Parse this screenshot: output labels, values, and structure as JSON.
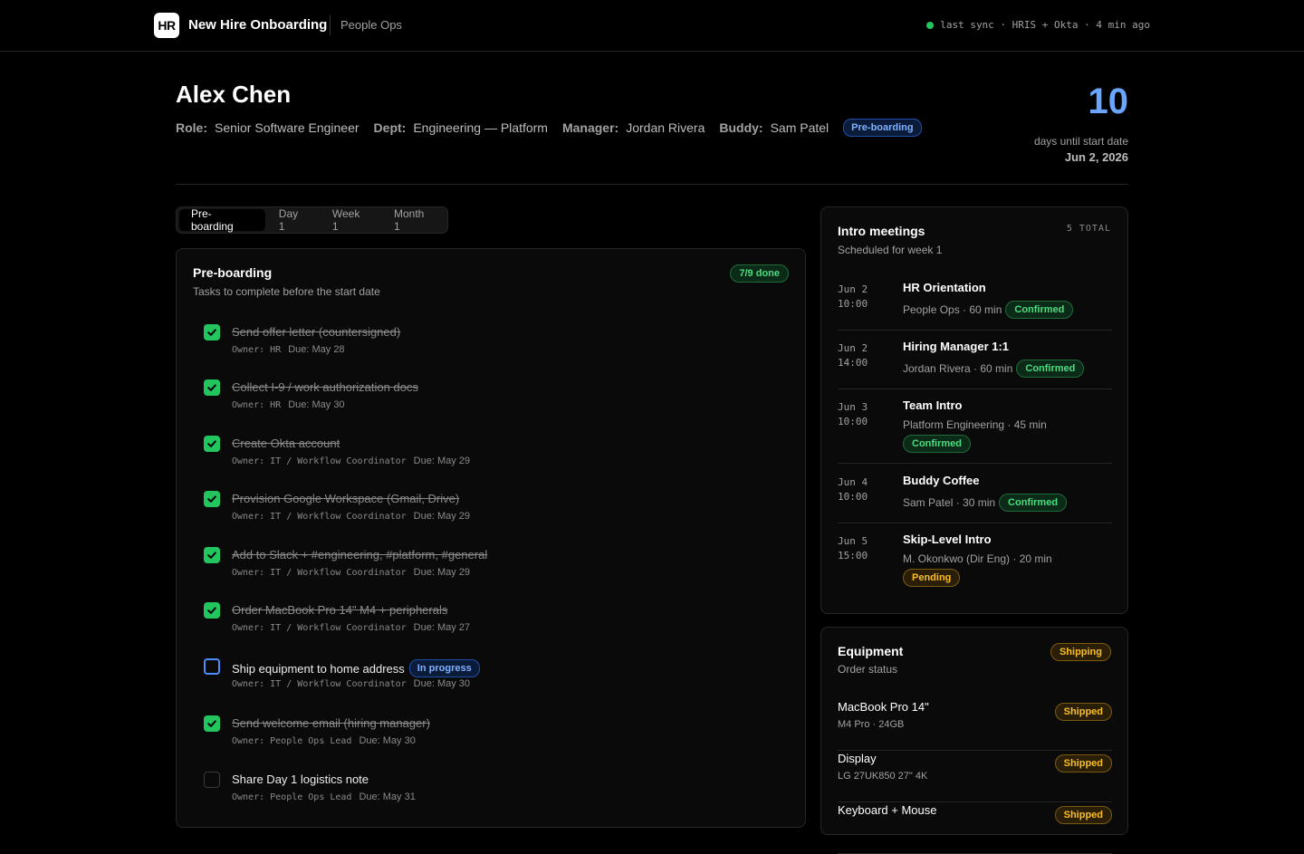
{
  "topbar": {
    "logo": "HR",
    "title": "New Hire Onboarding",
    "section": "People Ops",
    "sync_text": "last sync · HRIS + Okta · 4 min ago",
    "sync_color": "#22c55e"
  },
  "hire": {
    "name": "Alex Chen",
    "role_label": "Role:",
    "role": "Senior Software Engineer",
    "dept_label": "Dept:",
    "dept": "Engineering — Platform",
    "manager_label": "Manager:",
    "manager": "Jordan Rivera",
    "buddy_label": "Buddy:",
    "buddy": "Sam Patel",
    "status": "Pre-boarding"
  },
  "countdown": {
    "days": "10",
    "label": "days until start date",
    "date": "Jun 2, 2026"
  },
  "tabs": [
    {
      "label": "Pre-boarding",
      "active": true
    },
    {
      "label": "Day 1"
    },
    {
      "label": "Week 1"
    },
    {
      "label": "Month 1"
    }
  ],
  "tasks": {
    "title": "Pre-boarding",
    "subtitle": "Tasks to complete before the start date",
    "progress": "7/9 done",
    "items": [
      {
        "title": "Send offer letter (countersigned)",
        "owner": "Owner: HR",
        "due": "Due: May 28",
        "state": "done"
      },
      {
        "title": "Collect I-9 / work authorization docs",
        "owner": "Owner: HR",
        "due": "Due: May 30",
        "state": "done"
      },
      {
        "title": "Create Okta account",
        "owner": "Owner: IT / Workflow Coordinator",
        "due": "Due: May 29",
        "state": "done"
      },
      {
        "title": "Provision Google Workspace (Gmail, Drive)",
        "owner": "Owner: IT / Workflow Coordinator",
        "due": "Due: May 29",
        "state": "done"
      },
      {
        "title": "Add to Slack + #engineering, #platform, #general",
        "owner": "Owner: IT / Workflow Coordinator",
        "due": "Due: May 29",
        "state": "done"
      },
      {
        "title": "Order MacBook Pro 14\" M4 + peripherals",
        "owner": "Owner: IT / Workflow Coordinator",
        "due": "Due: May 27",
        "state": "done"
      },
      {
        "title": "Ship equipment to home address",
        "badge": "In progress",
        "owner": "Owner: IT / Workflow Coordinator",
        "due": "Due: May 30",
        "state": "in-progress"
      },
      {
        "title": "Send welcome email (hiring manager)",
        "owner": "Owner: People Ops Lead",
        "due": "Due: May 30",
        "state": "done"
      },
      {
        "title": "Share Day 1 logistics note",
        "owner": "Owner: People Ops Lead",
        "due": "Due: May 31",
        "state": "todo"
      }
    ]
  },
  "meetings": {
    "title": "Intro meetings",
    "subtitle": "Scheduled for week 1",
    "total": "5 TOTAL",
    "items": [
      {
        "date": "Jun 2",
        "time": "10:00",
        "title": "HR Orientation",
        "info": "People Ops · 60 min",
        "status": "Confirmed"
      },
      {
        "date": "Jun 2",
        "time": "14:00",
        "title": "Hiring Manager 1:1",
        "info": "Jordan Rivera · 60 min",
        "status": "Confirmed"
      },
      {
        "date": "Jun 3",
        "time": "10:00",
        "title": "Team Intro",
        "info": "Platform Engineering · 45 min",
        "status": "Confirmed"
      },
      {
        "date": "Jun 4",
        "time": "10:00",
        "title": "Buddy Coffee",
        "info": "Sam Patel · 30 min",
        "status": "Confirmed"
      },
      {
        "date": "Jun 5",
        "time": "15:00",
        "title": "Skip-Level Intro",
        "info": "M. Okonkwo (Dir Eng) · 20 min",
        "status": "Pending"
      }
    ]
  },
  "equipment": {
    "title": "Equipment",
    "subtitle": "Order status",
    "status": "Shipping",
    "items": [
      {
        "name": "MacBook Pro 14\"",
        "spec": "M4 Pro · 24GB",
        "status": "Shipped"
      },
      {
        "name": "Display",
        "spec": "LG 27UK850 27\" 4K",
        "status": "Shipped"
      },
      {
        "name": "Keyboard + Mouse",
        "spec": "",
        "status": "Shipped"
      }
    ]
  },
  "colors": {
    "accent_blue": "#6aa6ff",
    "success_green": "#22c55e",
    "warning_amber": "#fbbf24"
  }
}
